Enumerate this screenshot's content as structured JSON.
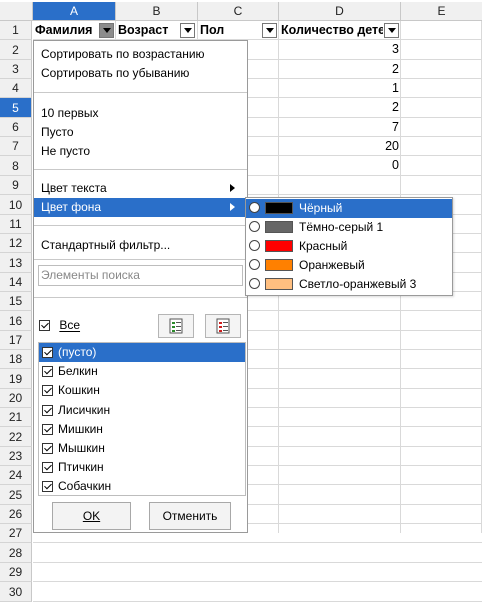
{
  "columns": [
    {
      "letter": "A",
      "selected": true
    },
    {
      "letter": "B",
      "selected": false
    },
    {
      "letter": "C",
      "selected": false
    },
    {
      "letter": "D",
      "selected": false
    },
    {
      "letter": "E",
      "selected": false
    }
  ],
  "rows": [
    "1",
    "2",
    "3",
    "4",
    "5",
    "6",
    "7",
    "8",
    "9",
    "10",
    "11",
    "12",
    "13",
    "14",
    "15",
    "16",
    "17",
    "18",
    "19",
    "20",
    "21",
    "22",
    "23",
    "24",
    "25",
    "26",
    "27",
    "28",
    "29",
    "30"
  ],
  "selected_row": "5",
  "header_cells": {
    "a": "Фамилия",
    "b": "Возраст",
    "c": "Пол",
    "d": "Количество детей"
  },
  "column_d_values": [
    "3",
    "2",
    "1",
    "2",
    "7",
    "20",
    "0"
  ],
  "popup": {
    "sort_asc": "Сортировать по возрастанию",
    "sort_desc": "Сортировать по убыванию",
    "top10": "10 первых",
    "empty": "Пусто",
    "not_empty": "Не пусто",
    "text_color": "Цвет текста",
    "bg_color": "Цвет фона",
    "standard_filter": "Стандартный фильтр...",
    "search_placeholder": "Элементы поиска",
    "all_label": "Все",
    "items": [
      "(пусто)",
      "Белкин",
      "Кошкин",
      "Лисичкин",
      "Мишкин",
      "Мышкин",
      "Птичкин",
      "Собачкин"
    ],
    "ok": "OK",
    "cancel": "Отменить"
  },
  "color_submenu": [
    {
      "label": "Чёрный",
      "color": "#000000"
    },
    {
      "label": "Тёмно-серый 1",
      "color": "#666666"
    },
    {
      "label": "Красный",
      "color": "#ff0000"
    },
    {
      "label": "Оранжевый",
      "color": "#ff8000"
    },
    {
      "label": "Светло-оранжевый 3",
      "color": "#ffbf80"
    }
  ],
  "accent": "#2a6fc9"
}
